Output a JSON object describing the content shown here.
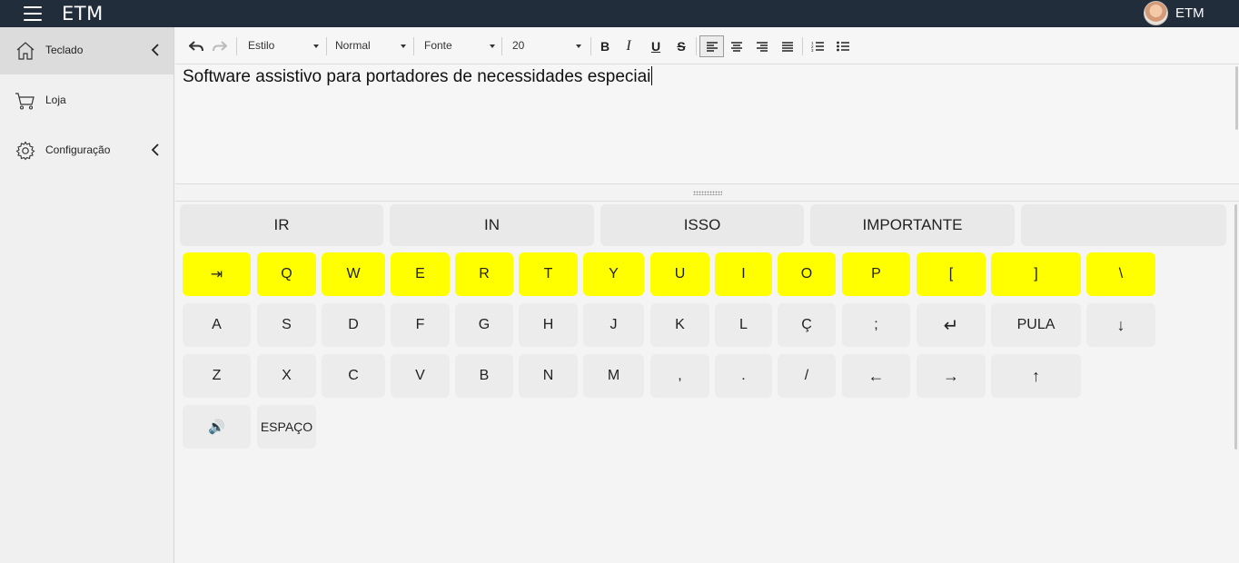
{
  "app": {
    "title": "ETM",
    "user_name": "ETM"
  },
  "sidebar": {
    "items": [
      {
        "label": "Teclado",
        "icon": "home-icon",
        "active": true,
        "has_chevron": true
      },
      {
        "label": "Loja",
        "icon": "cart-icon",
        "active": false,
        "has_chevron": false
      },
      {
        "label": "Configuração",
        "icon": "gear-icon",
        "active": false,
        "has_chevron": true
      }
    ]
  },
  "toolbar": {
    "style_select": "Estilo",
    "format_select": "Normal",
    "font_select": "Fonte",
    "size_select": "20",
    "bold": "B",
    "italic": "I",
    "underline": "U",
    "strike": "S",
    "icons": [
      "undo-icon",
      "redo-icon",
      "align-left-icon",
      "align-center-icon",
      "align-right-icon",
      "align-justify-icon",
      "numbered-list-icon",
      "bullet-list-icon"
    ]
  },
  "editor": {
    "text": "Software assistivo para portadores de necessidades especiai"
  },
  "keyboard": {
    "suggestions": [
      "IR",
      "IN",
      "ISSO",
      "IMPORTANTE",
      ""
    ],
    "row1": [
      "⇥",
      "Q",
      "W",
      "E",
      "R",
      "T",
      "Y",
      "U",
      "I",
      "O",
      "P",
      "[",
      "]",
      "\\"
    ],
    "row2": [
      "A",
      "S",
      "D",
      "F",
      "G",
      "H",
      "J",
      "K",
      "L",
      "Ç",
      ";",
      "↵",
      "PULA",
      "↓"
    ],
    "row3": [
      "Z",
      "X",
      "C",
      "V",
      "B",
      "N",
      "M",
      ",",
      ".",
      "/",
      "←",
      "→",
      "↑"
    ],
    "row4": [
      "🔊",
      "ESPAÇO"
    ],
    "highlight_color": "#ffff00"
  }
}
